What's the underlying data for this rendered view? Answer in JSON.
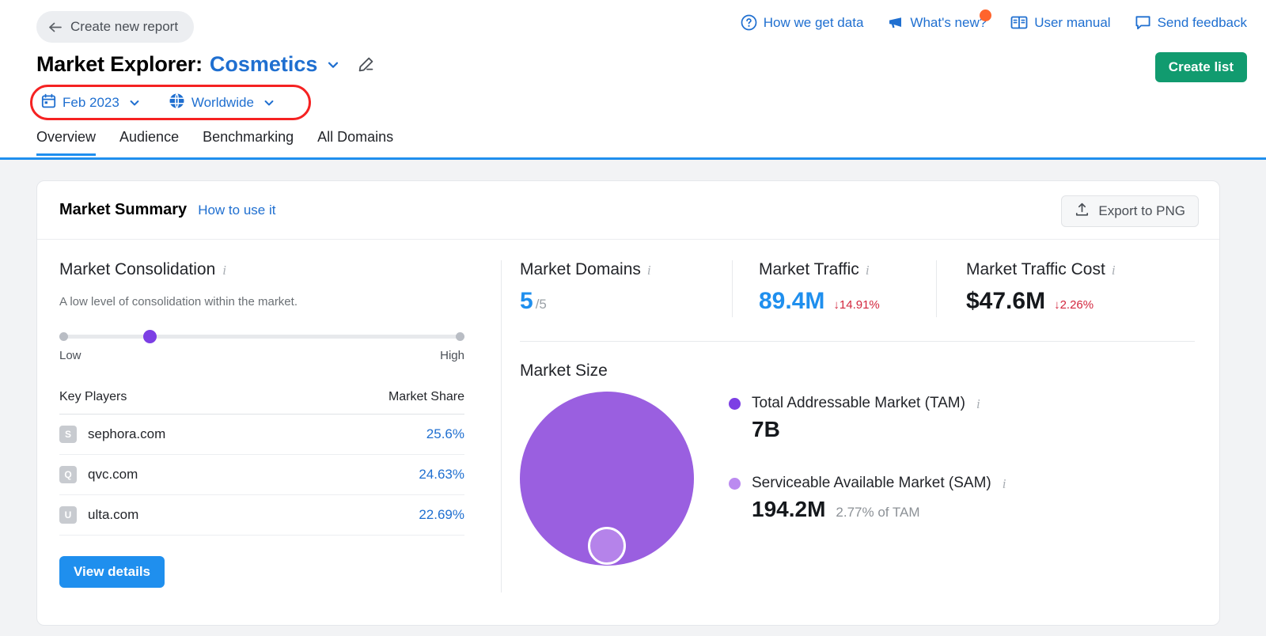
{
  "header": {
    "back_button": "Create new report",
    "back_icon": "arrow-left-icon",
    "title_prefix": "Market Explorer:",
    "title_value": "Cosmetics",
    "title_chevron_icon": "chevron-down-icon",
    "edit_icon": "pencil-icon",
    "create_list_button": "Create list",
    "links": [
      {
        "label": "How we get data",
        "icon": "question-circle-icon",
        "badge": false
      },
      {
        "label": "What's new?",
        "icon": "megaphone-icon",
        "badge": true
      },
      {
        "label": "User manual",
        "icon": "book-icon",
        "badge": false
      },
      {
        "label": "Send feedback",
        "icon": "speech-bubble-icon",
        "badge": false
      }
    ],
    "filters": [
      {
        "label": "Feb 2023",
        "icon": "calendar-icon"
      },
      {
        "label": "Worldwide",
        "icon": "globe-icon"
      }
    ],
    "highlight_color": "#f52222",
    "tabs": [
      {
        "label": "Overview",
        "active": true
      },
      {
        "label": "Audience",
        "active": false
      },
      {
        "label": "Benchmarking",
        "active": false
      },
      {
        "label": "All Domains",
        "active": false
      }
    ]
  },
  "card": {
    "title": "Market Summary",
    "how_to_link": "How to use it",
    "export_button": "Export to PNG",
    "export_icon": "upload-icon"
  },
  "consolidation": {
    "title": "Market Consolidation",
    "description": "A low level of consolidation within the market.",
    "slider_low_label": "Low",
    "slider_high_label": "High",
    "slider_position_pct": 21,
    "thumb_color": "#7c3fe4",
    "table": {
      "col_domain": "Key Players",
      "col_share": "Market Share",
      "rows": [
        {
          "initial": "S",
          "domain": "sephora.com",
          "share": "25.6%"
        },
        {
          "initial": "Q",
          "domain": "qvc.com",
          "share": "24.63%"
        },
        {
          "initial": "U",
          "domain": "ulta.com",
          "share": "22.69%"
        }
      ]
    },
    "view_details_button": "View details"
  },
  "metrics": [
    {
      "label": "Market Domains",
      "value": "5",
      "suffix": "/5",
      "delta": "",
      "value_color": "#1f8fee"
    },
    {
      "label": "Market Traffic",
      "value": "89.4M",
      "suffix": "",
      "delta": "↓14.91%",
      "value_color": "#1f8fee"
    },
    {
      "label": "Market Traffic Cost",
      "value": "$47.6M",
      "suffix": "",
      "delta": "↓2.26%",
      "value_color": "#15181c"
    }
  ],
  "market_size": {
    "title": "Market Size",
    "legend": [
      {
        "label": "Total Addressable Market (TAM)",
        "value": "7B",
        "note": "",
        "color": "#7c3fe4"
      },
      {
        "label": "Serviceable Available Market (SAM)",
        "value": "194.2M",
        "note": "2.77% of TAM",
        "color": "#bb8af0"
      }
    ]
  },
  "chart_data": {
    "type": "bubble",
    "title": "Market Size",
    "series": [
      {
        "name": "Total Addressable Market (TAM)",
        "display_value": "7B",
        "numeric_value": 7000000000,
        "radius_px": 110,
        "color": "#9a5fe0"
      },
      {
        "name": "Serviceable Available Market (SAM)",
        "display_value": "194.2M",
        "numeric_value": 194200000,
        "radius_px": 24,
        "color": "#b583ea",
        "share_of_tam": "2.77% of TAM"
      }
    ],
    "legend_position": "right",
    "grid": false
  }
}
